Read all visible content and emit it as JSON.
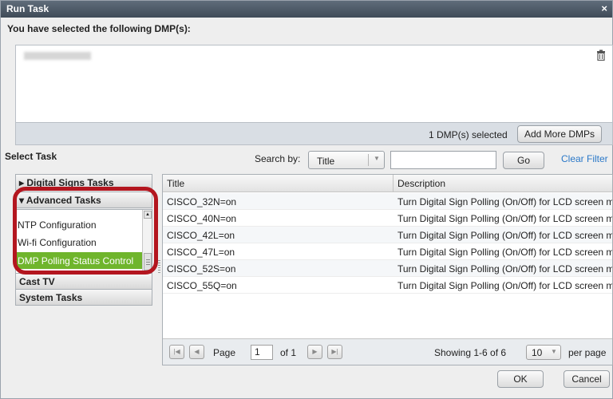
{
  "dialog": {
    "title": "Run Task",
    "close": "×"
  },
  "selection": {
    "label": "You have selected the following DMP(s):",
    "count_text": "1 DMP(s) selected",
    "add_button": "Add More DMPs"
  },
  "select_task_label": "Select Task",
  "search": {
    "label": "Search by:",
    "field": "Title",
    "value": "",
    "go_button": "Go",
    "clear_link": "Clear Filter"
  },
  "task_groups": {
    "digital_signs": "▸ Digital Signs Tasks",
    "advanced": "▾ Advanced Tasks",
    "advanced_items": [
      "NTP Configuration",
      "Wi-fi Configuration",
      "DMP Polling Status Control"
    ],
    "cast_tv": "Cast TV",
    "system": "System Tasks"
  },
  "grid": {
    "columns": [
      "Title",
      "Description"
    ],
    "rows": [
      {
        "title": "CISCO_32N=on",
        "description": "Turn Digital Sign Polling (On/Off) for LCD screen m"
      },
      {
        "title": "CISCO_40N=on",
        "description": "Turn Digital Sign Polling (On/Off) for LCD screen m"
      },
      {
        "title": "CISCO_42L=on",
        "description": "Turn Digital Sign Polling (On/Off) for LCD screen m"
      },
      {
        "title": "CISCO_47L=on",
        "description": "Turn Digital Sign Polling (On/Off) for LCD screen m"
      },
      {
        "title": "CISCO_52S=on",
        "description": "Turn Digital Sign Polling (On/Off) for LCD screen m"
      },
      {
        "title": "CISCO_55Q=on",
        "description": "Turn Digital Sign Polling (On/Off) for LCD screen m"
      }
    ]
  },
  "pagination": {
    "page_label": "Page",
    "page_value": "1",
    "of_label": "of 1",
    "showing": "Showing 1-6 of 6",
    "per_page_value": "10",
    "per_page_label": "per page"
  },
  "actions": {
    "ok": "OK",
    "cancel": "Cancel"
  },
  "colors": {
    "title_bar": "#4a5663",
    "selected_item": "#6fb52c",
    "highlight": "#b3161f",
    "link": "#2a78c8"
  }
}
